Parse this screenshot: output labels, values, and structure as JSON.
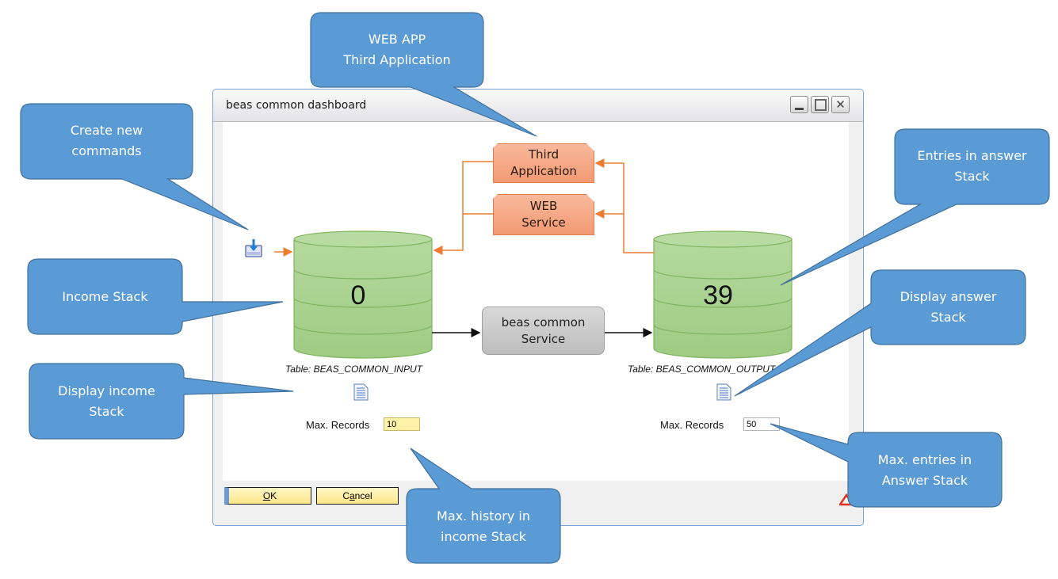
{
  "window": {
    "title": "beas common dashboard",
    "controls": {
      "minimize": "minimize",
      "maximize": "maximize",
      "close": "✕"
    }
  },
  "diagram": {
    "import_icon": "import-command-icon",
    "income_stack": {
      "value": "0",
      "table_label": "Table: BEAS_COMMON_INPUT",
      "max_records_label": "Max. Records",
      "max_records_value": "10"
    },
    "answer_stack": {
      "value": "39",
      "table_label": "Table: BEAS_COMMON_OUTPUT",
      "max_records_label": "Max. Records",
      "max_records_value": "50"
    },
    "nodes": {
      "third_application": "Third Application",
      "web_service": "WEB Service",
      "beas_common_service": "beas common Service"
    },
    "colors": {
      "stack_green": "#a9d18e",
      "flow_orange": "#ed7d31",
      "callout_blue": "#5b9bd5"
    }
  },
  "footer": {
    "ok_label": "OK",
    "ok_mnemonic": "O",
    "cancel_label": "Cancel",
    "cancel_pre": "C",
    "cancel_mnemonic": "a",
    "cancel_post": "ncel"
  },
  "callouts": [
    {
      "id": "web-app",
      "text": "WEB APP\nThird Application"
    },
    {
      "id": "create-commands",
      "text": "Create new commands"
    },
    {
      "id": "income-stack",
      "text": "Income Stack"
    },
    {
      "id": "display-income",
      "text": "Display income Stack"
    },
    {
      "id": "max-history",
      "text": "Max. history in income Stack"
    },
    {
      "id": "entries-answer",
      "text": "Entries in answer Stack"
    },
    {
      "id": "display-answer",
      "text": "Display answer Stack"
    },
    {
      "id": "max-entries",
      "text": "Max. entries in Answer Stack"
    }
  ],
  "callout_lines": {
    "web_app": [
      "WEB APP",
      "Third Application"
    ],
    "create_commands": [
      "Create new",
      "commands"
    ],
    "income_stack": [
      "Income Stack"
    ],
    "display_income": [
      "Display income",
      "Stack"
    ],
    "max_history": [
      "Max. history in",
      "income Stack"
    ],
    "entries_answer": [
      "Entries in answer",
      "Stack"
    ],
    "display_answer": [
      "Display answer",
      "Stack"
    ],
    "max_entries": [
      "Max. entries in",
      "Answer Stack"
    ]
  }
}
